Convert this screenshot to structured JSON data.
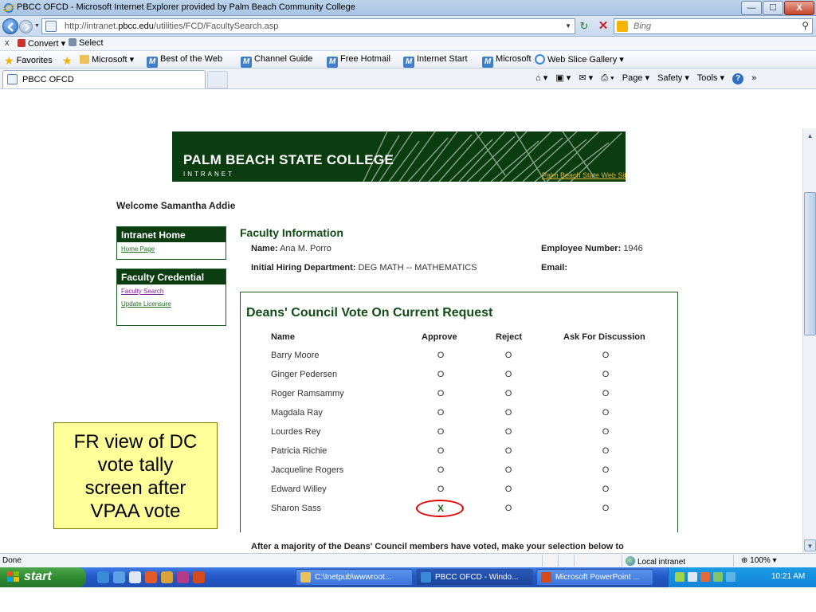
{
  "window": {
    "title": "PBCC OFCD - Microsoft Internet Explorer provided by Palm Beach Community College",
    "minimize": "—",
    "maximize": "☐",
    "close": "X"
  },
  "address": {
    "url_prefix": "http://intranet.",
    "url_domain": "pbcc.edu",
    "url_path": "/utilities/FCD/FacultySearch.asp",
    "refresh": "↻",
    "stop": "✕",
    "search_placeholder": "Bing"
  },
  "command_bar": {
    "close": "x",
    "convert": "Convert ▾",
    "select": "Select"
  },
  "favorites_bar": {
    "favorites": "Favorites",
    "items": [
      {
        "label": "Microsoft ▾"
      },
      {
        "label": "Best of the Web"
      },
      {
        "label": "Channel Guide"
      },
      {
        "label": "Free Hotmail"
      },
      {
        "label": "Internet Start"
      },
      {
        "label": "Microsoft"
      },
      {
        "label": "Web Slice Gallery ▾"
      }
    ]
  },
  "tabs": {
    "active_label": "PBCC OFCD",
    "tools": {
      "home": "⌂ ▾",
      "feeds": "▣ ▾",
      "mail": "✉ ▾",
      "print": "⎙ ▾",
      "page": "Page ▾",
      "safety": "Safety ▾",
      "tools": "Tools ▾",
      "help": "?",
      "more": "»"
    }
  },
  "banner": {
    "college": "PALM BEACH STATE COLLEGE",
    "intranet": "INTRANET",
    "web_site_link": "Palm Beach State Web Site"
  },
  "welcome": "Welcome Samantha Addie",
  "sidebar": {
    "box1": {
      "title": "Intranet Home",
      "links": [
        "Home Page"
      ]
    },
    "box2": {
      "title": "Faculty Credential",
      "links": [
        "Faculty Search",
        "Update Licensure"
      ]
    }
  },
  "faculty": {
    "section_title": "Faculty Information",
    "name_label": "Name:",
    "name_value": "Ana M. Porro",
    "employee_label": "Employee Number:",
    "employee_value": "1946",
    "dept_label": "Initial Hiring Department:",
    "dept_value": "DEG MATH -- MATHEMATICS",
    "email_label": "Email:",
    "email_value": ""
  },
  "vote": {
    "title": "Deans' Council Vote On Current Request",
    "headers": {
      "name": "Name",
      "approve": "Approve",
      "reject": "Reject",
      "discuss": "Ask For Discussion"
    },
    "rows": [
      {
        "name": "Barry Moore",
        "approve": "O",
        "reject": "O",
        "discuss": "O"
      },
      {
        "name": "Ginger Pedersen",
        "approve": "O",
        "reject": "O",
        "discuss": "O"
      },
      {
        "name": "Roger Ramsammy",
        "approve": "O",
        "reject": "O",
        "discuss": "O"
      },
      {
        "name": "Magdala Ray",
        "approve": "O",
        "reject": "O",
        "discuss": "O"
      },
      {
        "name": "Lourdes Rey",
        "approve": "O",
        "reject": "O",
        "discuss": "O"
      },
      {
        "name": "Patricia Richie",
        "approve": "O",
        "reject": "O",
        "discuss": "O"
      },
      {
        "name": "Jacqueline Rogers",
        "approve": "O",
        "reject": "O",
        "discuss": "O"
      },
      {
        "name": "Edward Willey",
        "approve": "O",
        "reject": "O",
        "discuss": "O"
      },
      {
        "name": "Sharon Sass",
        "approve": "X",
        "reject": "O",
        "discuss": "O"
      }
    ],
    "footer": "After a majority of the Deans' Council members have voted, make your selection below to"
  },
  "callout": {
    "lines": [
      "FR view of DC",
      "vote tally",
      "screen after",
      "VPAA vote"
    ]
  },
  "status": {
    "text": "Done",
    "zone": "Local intranet",
    "zoom": "100%  ▾"
  },
  "taskbar": {
    "start": "start",
    "buttons": [
      {
        "label": "C:\\Inetpub\\wwwroot..."
      },
      {
        "label": "PBCC OFCD - Windo..."
      },
      {
        "label": "Microsoft PowerPoint ..."
      }
    ],
    "clock": "10:21 AM"
  },
  "colors": {
    "brand_green": "#0c3d11",
    "heading_green": "#124d17",
    "link_gold": "#e1b63a",
    "callout_yellow": "#ffff99",
    "highlight_red": "#e00000"
  }
}
